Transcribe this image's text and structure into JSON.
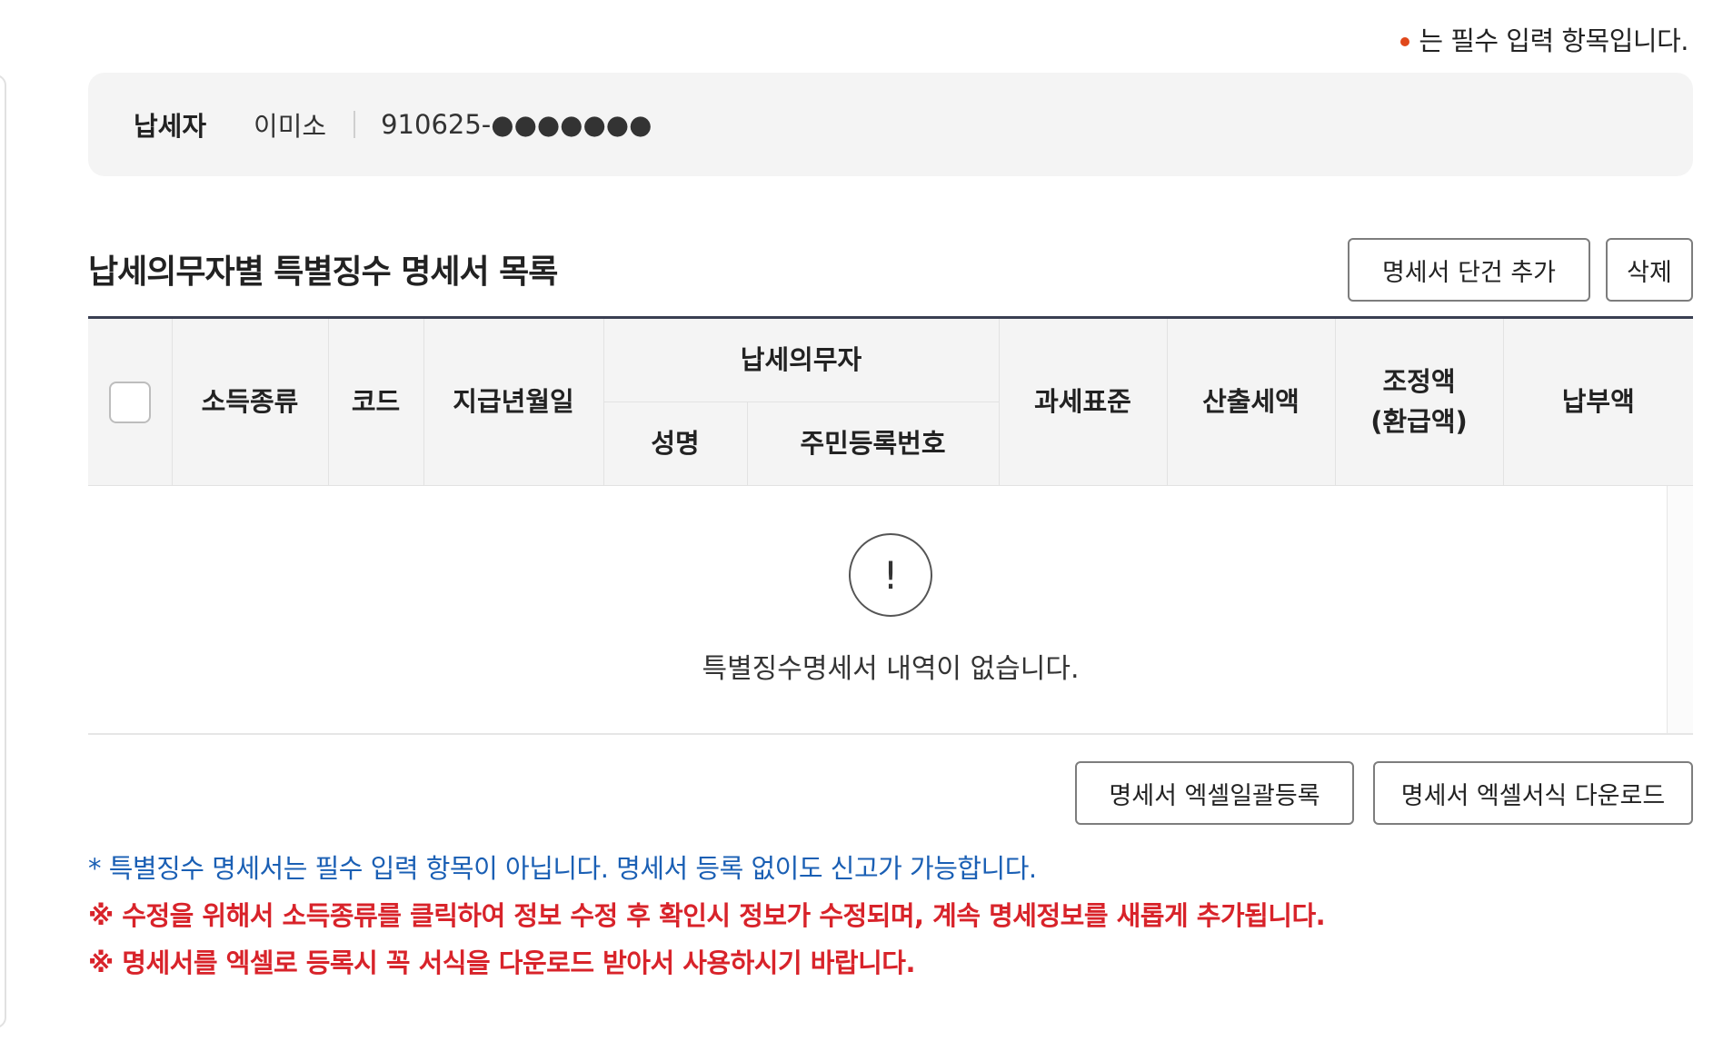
{
  "required_note": "는 필수 입력 항목입니다.",
  "taxpayer": {
    "label": "납세자",
    "name": "이미소",
    "rrn": "910625-●●●●●●●"
  },
  "section": {
    "title": "납세의무자별 특별징수 명세서 목록",
    "add_button": "명세서 단건 추가",
    "delete_button": "삭제"
  },
  "table": {
    "headers": {
      "income_type": "소득종류",
      "code": "코드",
      "pay_date": "지급년월일",
      "obligor": "납세의무자",
      "name": "성명",
      "rrn": "주민등록번호",
      "tax_base": "과세표준",
      "calculated_tax": "산출세액",
      "adjustment_line1": "조정액",
      "adjustment_line2": "(환급액)",
      "payment": "납부액"
    },
    "empty_icon": "!",
    "empty_message": "특별징수명세서 내역이 없습니다."
  },
  "bottom_buttons": {
    "excel_upload": "명세서 엑셀일괄등록",
    "excel_template": "명세서 엑셀서식 다운로드"
  },
  "notes": {
    "info": "* 특별징수 명세서는 필수 입력 항목이 아닙니다. 명세서 등록 없이도 신고가 가능합니다.",
    "warning1": "※ 수정을 위해서 소득종류를 클릭하여 정보 수정 후 확인시 정보가 수정되며, 계속 명세정보를 새롭게 추가됩니다.",
    "warning2": "※ 명세서를 엑셀로 등록시 꼭 서식을 다운로드 받아서 사용하시기 바랍니다."
  },
  "colors": {
    "required_dot": "#e0481b",
    "info_blue": "#1a5fb4",
    "warning_red": "#d8232a",
    "table_top_border": "#3a3f52"
  }
}
